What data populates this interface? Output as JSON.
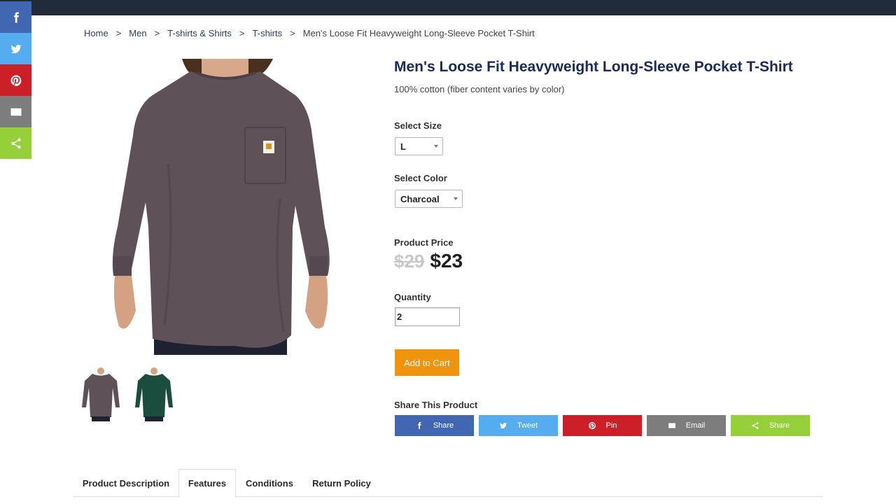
{
  "colors": {
    "facebook": "#4267b2",
    "twitter": "#55acee",
    "pinterest": "#cb2027",
    "email": "#7d7d7d",
    "sharethis": "#95d03a",
    "accent": "#f0930f",
    "title": "#1b2a5c",
    "topbar": "#222b3a"
  },
  "sidebar": {
    "items": [
      {
        "icon": "facebook-icon"
      },
      {
        "icon": "twitter-icon"
      },
      {
        "icon": "pinterest-icon"
      },
      {
        "icon": "email-icon"
      },
      {
        "icon": "share-icon"
      }
    ]
  },
  "breadcrumb": {
    "items": [
      "Home",
      "Men",
      "T-shirts & Shirts",
      "T-shirts"
    ],
    "separator": ">",
    "current": "Men's Loose Fit Heavyweight Long-Sleeve Pocket T-Shirt"
  },
  "product": {
    "title": "Men's Loose Fit Heavyweight Long-Sleeve Pocket T-Shirt",
    "subtitle": "100% cotton (fiber content varies by color)",
    "size_label": "Select Size",
    "size_value": "L",
    "color_label": "Select Color",
    "color_value": "Charcoal",
    "price_label": "Product Price",
    "old_price": "$29",
    "new_price": "$23",
    "quantity_label": "Quantity",
    "quantity_value": "2",
    "add_to_cart": "Add to Cart",
    "share_label": "Share This Product"
  },
  "share_buttons": [
    {
      "label": "Share",
      "icon": "facebook-icon"
    },
    {
      "label": "Tweet",
      "icon": "twitter-icon"
    },
    {
      "label": "Pin",
      "icon": "pinterest-icon"
    },
    {
      "label": "Email",
      "icon": "email-icon"
    },
    {
      "label": "Share",
      "icon": "share-icon"
    }
  ],
  "thumbnails": [
    {
      "color": "charcoal"
    },
    {
      "color": "green"
    }
  ],
  "tabs": [
    {
      "label": "Product Description"
    },
    {
      "label": "Features",
      "active": true
    },
    {
      "label": "Conditions"
    },
    {
      "label": "Return Policy"
    }
  ]
}
